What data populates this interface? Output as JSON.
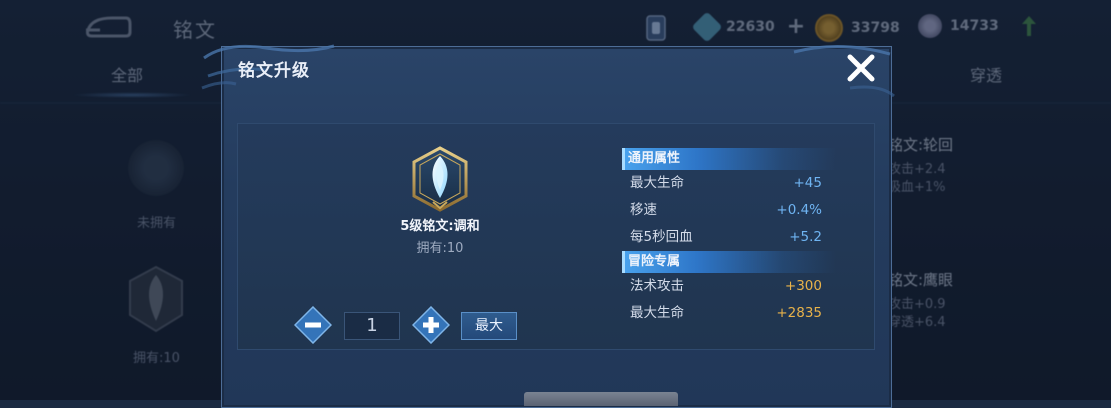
{
  "background": {
    "title": "铭文",
    "currencies": [
      {
        "icon": "diamond-gem-icon",
        "value": "22630"
      },
      {
        "icon": "gold-coin-icon",
        "value": "33798"
      },
      {
        "icon": "crystal-icon",
        "value": "14733"
      }
    ],
    "tabs": {
      "all": "全部",
      "pierce": "穿透"
    },
    "cards": [
      {
        "name": "铭文:轮回",
        "stats": [
          "攻击+2.4",
          "吸血+1%"
        ]
      },
      {
        "name": "铭文:鹰眼",
        "stats": [
          "攻击+0.9",
          "穿透+6.4"
        ]
      }
    ],
    "left_cards": [
      {
        "label": "未拥有"
      },
      {
        "label": "拥有:10"
      }
    ]
  },
  "modal": {
    "title": "铭文升级",
    "close_icon": "close-icon",
    "rune": {
      "name": "5级铭文:调和",
      "owned": "拥有:10",
      "icon": "rune-crystal-icon"
    },
    "quantity": "1",
    "max_label": "最大",
    "sections": [
      {
        "header": "通用属性",
        "rows": [
          {
            "label": "最大生命",
            "value": "+45",
            "color": "#6fb4f2"
          },
          {
            "label": "移速",
            "value": "+0.4%",
            "color": "#6fb4f2"
          },
          {
            "label": "每5秒回血",
            "value": "+5.2",
            "color": "#6fb4f2"
          }
        ]
      },
      {
        "header": "冒险专属",
        "rows": [
          {
            "label": "法术攻击",
            "value": "+300",
            "color": "#e8b24a"
          },
          {
            "label": "最大生命",
            "value": "+2835",
            "color": "#e8b24a"
          }
        ]
      }
    ]
  }
}
